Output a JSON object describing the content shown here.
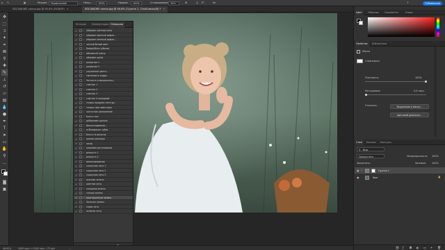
{
  "optionbar": {
    "mode_label": "Режим:",
    "mode_value": "Нормальный",
    "opacity_label": "Непр.:",
    "opacity_value": "100%",
    "pressure_label": "Нажим:",
    "pressure_value": "100%",
    "smoothing_label": "Сглаживание:",
    "smoothing_value": "10%",
    "angle_value": "0°",
    "publish_label": "Публикация"
  },
  "tabs": [
    {
      "label": "0DC0A8365 копия.jpg @ 65,8% (RGB/8*)",
      "close": "×"
    },
    {
      "label": "0DC0A8365 копия.jpg @ 46,6% (Группа 1, Слой-маска/8) *",
      "close": "×"
    }
  ],
  "actions_panel": {
    "tabs": [
      "История",
      "Комментарии",
      "Операции"
    ],
    "rows": [
      "убираем грязные пяна",
      "убираем красный рефле...",
      "убираем зеленый рефле...",
      "чистый белый цвет",
      "Dodge&Burn (объем)",
      "объемный тренд",
      "убираем шумы",
      "размытие 1",
      "размытие 2",
      "улучшение цвета...",
      "светимость кадра",
      "Четкость и микроконтр...",
      "снэптон 1",
      "снэптон 2",
      "снэптон 3",
      "снэптон 4 холодный",
      "только придаем текстур...",
      "только смягчаем кожу",
      "частотное разложение",
      "Блеск глаз",
      "добавляем румяна",
      "Виньетирование...",
      "отбеливание зубов",
      "Блеск на волосах",
      "красим ресницы",
      "загар",
      "красивая детализация",
      "резкость 1",
      "резкость 2",
      "виньетирование",
      "сказочное лето 1",
      "сказочное лето 2",
      "сказочное лето 3",
      "осенняя зелень",
      "цветное лето",
      "холодная зелень",
      "теплая зелень",
      "приглушенная зелень",
      "Золотые зелень",
      "серое лето",
      "зеленое лето"
    ],
    "selected_index": 37,
    "check": "✓",
    "arrow": "›"
  },
  "status": {
    "zoom": "46,62%",
    "doc_info": "3000 пикс. x 2000 пикс. (72 ppi)"
  },
  "right": {
    "color_tabs": [
      "Цвет",
      "Образцы",
      "Градиенты",
      "Узоры"
    ],
    "props_tabs": [
      "Свойства",
      "Библиотеки"
    ],
    "mask_title": "Маски",
    "layer_mask_label": "Слой-маска",
    "density_label": "Плотность:",
    "density_value": "100%",
    "feather_label": "Растушевка:",
    "feather_value": "0,0 пикс.",
    "refine_label": "Уточнить:",
    "select_mask_btn": "Выделение и маска...",
    "color_range_btn": "Цветовой диапазон...",
    "layers_tabs": [
      "Слои",
      "Каналы",
      "Контуры"
    ],
    "kind_label": "Вид",
    "blend_value": "Пропустить",
    "opacity_label": "Непрозрачность:",
    "opacity_value": "100%",
    "lock_label": "Закрепить:",
    "fill_label": "Заливка:",
    "fill_value": "100%",
    "layers": [
      {
        "name": "Группа 1",
        "selected": true
      },
      {
        "name": "Фон",
        "selected": false
      }
    ]
  },
  "colors": {
    "accent": "#1473e6",
    "photo_bg": "#5b7063",
    "dress": "#e8edf0"
  }
}
